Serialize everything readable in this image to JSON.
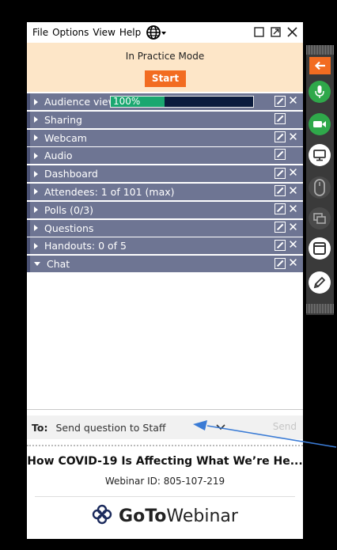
{
  "menu": {
    "file": "File",
    "options": "Options",
    "view": "View",
    "help": "Help"
  },
  "practice": {
    "label": "In Practice Mode",
    "start": "Start"
  },
  "sections": [
    {
      "label": "Audience view",
      "has_close": true,
      "expanded": false
    },
    {
      "label": "Sharing",
      "has_close": false,
      "expanded": false
    },
    {
      "label": "Webcam",
      "has_close": true,
      "expanded": false
    },
    {
      "label": "Audio",
      "has_close": false,
      "expanded": false
    },
    {
      "label": "Dashboard",
      "has_close": true,
      "expanded": false
    },
    {
      "label": "Attendees: 1 of 101 (max)",
      "has_close": true,
      "expanded": false
    },
    {
      "label": "Polls (0/3)",
      "has_close": true,
      "expanded": false
    },
    {
      "label": "Questions",
      "has_close": true,
      "expanded": false
    },
    {
      "label": "Handouts: 0 of 5",
      "has_close": true,
      "expanded": false
    },
    {
      "label": "Chat",
      "has_close": true,
      "expanded": true
    }
  ],
  "audience_progress": {
    "percent_text": "100%",
    "value": 1.0
  },
  "chat": {
    "to_label": "To:",
    "recipient": "Send question to Staff",
    "send": "Send"
  },
  "webinar": {
    "title": "How COVID-19 Is Affecting What We’re He...",
    "id_text": "Webinar ID: 805-107-219"
  },
  "brand": {
    "goto": "GoTo",
    "webinar": "Webinar"
  },
  "colors": {
    "accent_orange": "#f26c21",
    "section_bg": "#6e7593",
    "practice_bg": "#fde6c8",
    "green": "#1aa770",
    "annotation_blue": "#3a7bd5"
  },
  "toolbar_icons": [
    "collapse-arrow-icon",
    "microphone-icon",
    "webcam-icon",
    "screen-share-icon",
    "mouse-icon",
    "windows-icon",
    "window-icon",
    "pen-icon"
  ]
}
